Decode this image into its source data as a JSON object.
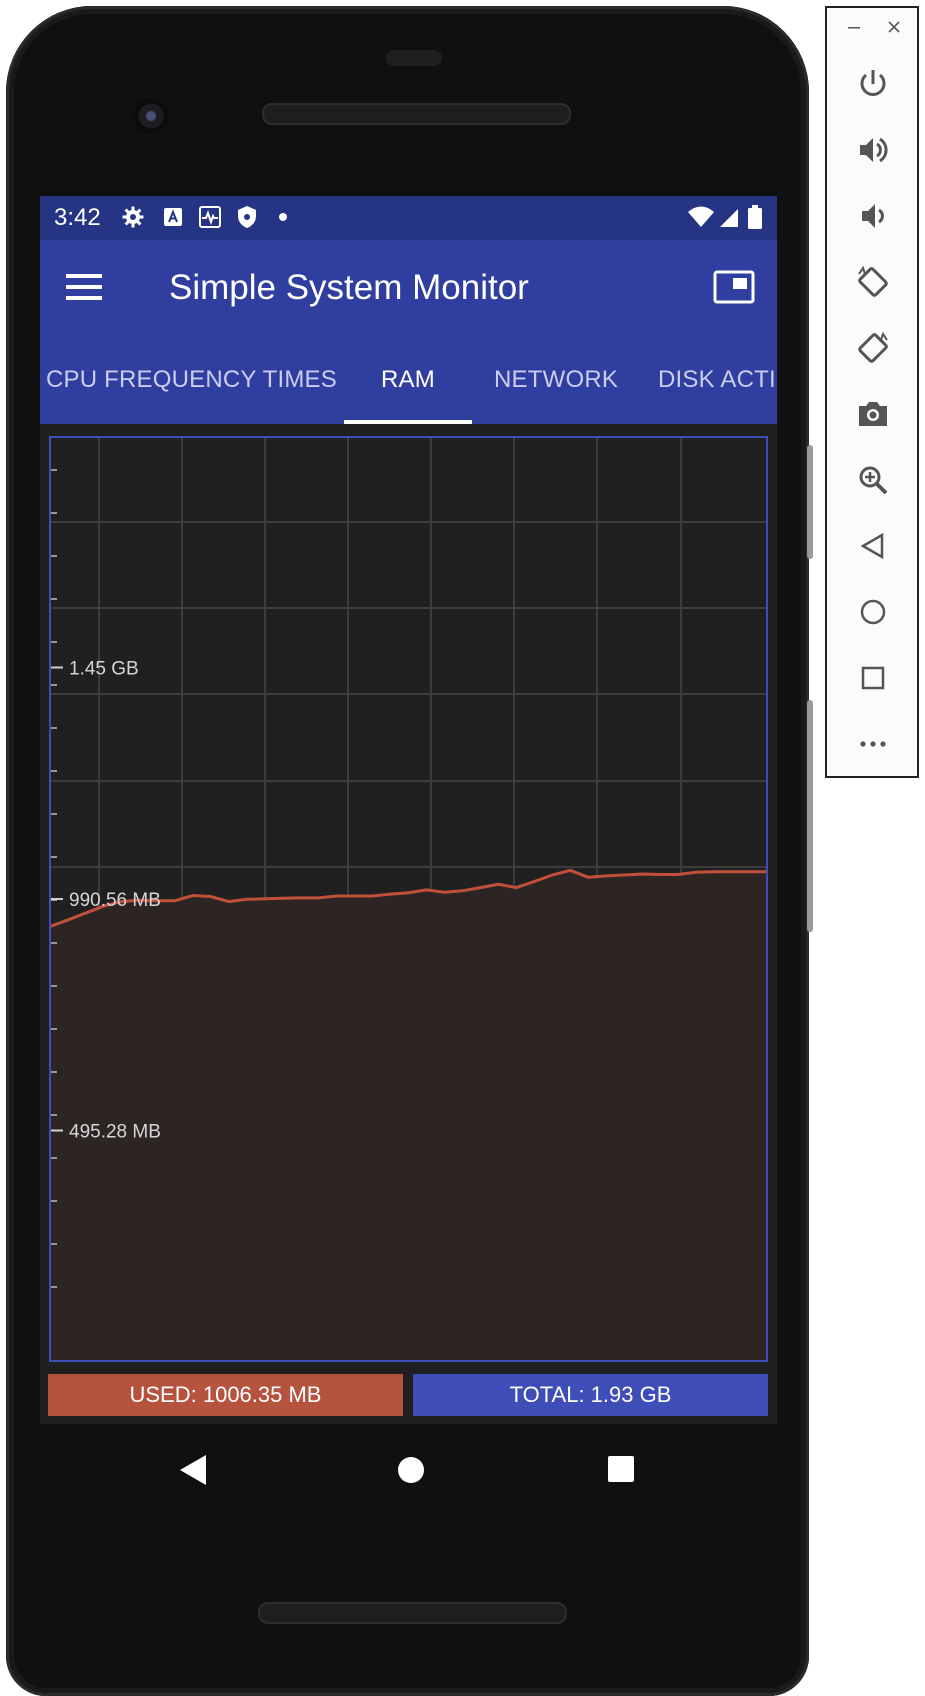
{
  "status_bar": {
    "time": "3:42",
    "left_icons": [
      "gear-icon",
      "a-box-icon",
      "pulse-icon",
      "shield-icon",
      "dot-icon"
    ],
    "right_icons": [
      "wifi-icon",
      "signal-icon",
      "battery-icon"
    ]
  },
  "app_bar": {
    "title": "Simple System Monitor",
    "menu_icon": "hamburger-menu-icon",
    "action_icon": "picture-in-picture-icon"
  },
  "tabs": [
    {
      "label": "CPU FREQUENCY TIMES",
      "active": false
    },
    {
      "label": "RAM",
      "active": true
    },
    {
      "label": "NETWORK",
      "active": false
    },
    {
      "label": "DISK ACTI",
      "active": false
    }
  ],
  "chart_data": {
    "type": "area",
    "y_tick_labels": [
      "1.45 GB",
      "990.56 MB",
      "495.28 MB"
    ],
    "y_tick_values_mb": [
      1485.84,
      990.56,
      495.28
    ],
    "ylim_mb": [
      0,
      1981.12
    ],
    "grid": true,
    "series": [
      {
        "color": "#c0503a",
        "values_mb": [
          931,
          945,
          960,
          975,
          985,
          988,
          987,
          987,
          998,
          996,
          985,
          990,
          991,
          992,
          993,
          993,
          997,
          997,
          997,
          1001,
          1004,
          1010,
          1005,
          1008,
          1015,
          1022,
          1015,
          1028,
          1042,
          1052,
          1037,
          1040,
          1042,
          1044,
          1043,
          1043,
          1048,
          1049,
          1049,
          1049,
          1049
        ]
      }
    ],
    "colors": {
      "line": "#c0503a",
      "fill": "#2d2424",
      "grid": "#3c3c3c",
      "frame": "#3f4db8"
    }
  },
  "legend": {
    "used": "USED: 1006.35 MB",
    "total": "TOTAL: 1.93 GB",
    "used_color": "#b5533e",
    "total_color": "#3f4db8"
  },
  "nav_bar": {
    "icons": [
      "back-triangle-icon",
      "home-circle-icon",
      "recents-square-icon"
    ]
  },
  "emulator_toolbar": {
    "window_controls": [
      "minimize-icon",
      "close-icon"
    ],
    "buttons": [
      "power-icon",
      "volume-up-icon",
      "volume-down-icon",
      "rotate-left-icon",
      "rotate-right-icon",
      "camera-icon",
      "zoom-icon",
      "back-icon",
      "home-icon",
      "overview-icon",
      "more-icon"
    ]
  }
}
